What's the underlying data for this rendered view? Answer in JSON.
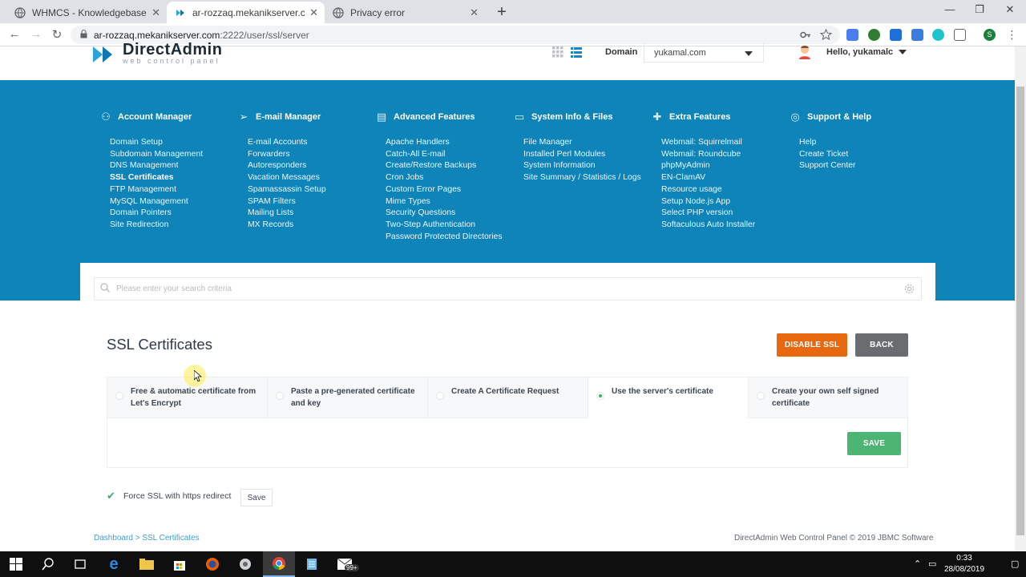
{
  "browser": {
    "tabs": [
      {
        "title": "WHMCS - Knowledgebase"
      },
      {
        "title": "ar-rozzaq.mekanikserver.com | S"
      },
      {
        "title": "Privacy error"
      }
    ],
    "url_host": "ar-rozzaq.mekanikserver.com",
    "url_path": ":2222/user/ssl/server"
  },
  "header": {
    "logo_title": "DirectAdmin",
    "logo_subtitle": "web control panel",
    "domain_label": "Domain",
    "domain_value": "yukamal.com",
    "greeting": "Hello, yukamalc"
  },
  "menu": [
    {
      "title": "Account Manager",
      "icon": "users-icon",
      "items": [
        "Domain Setup",
        "Subdomain Management",
        "DNS Management",
        "SSL Certificates",
        "FTP Management",
        "MySQL Management",
        "Domain Pointers",
        "Site Redirection"
      ]
    },
    {
      "title": "E-mail Manager",
      "icon": "paper-plane-icon",
      "items": [
        "E-mail Accounts",
        "Forwarders",
        "Autoresponders",
        "Vacation Messages",
        "Spamassassin Setup",
        "SPAM Filters",
        "Mailing Lists",
        "MX Records"
      ]
    },
    {
      "title": "Advanced Features",
      "icon": "table-icon",
      "items": [
        "Apache Handlers",
        "Catch-All E-mail",
        "Create/Restore Backups",
        "Cron Jobs",
        "Custom Error Pages",
        "Mime Types",
        "Security Questions",
        "Two-Step Authentication",
        "Password Protected Directories"
      ]
    },
    {
      "title": "System Info & Files",
      "icon": "drive-icon",
      "items": [
        "File Manager",
        "Installed Perl Modules",
        "System Information",
        "Site Summary / Statistics / Logs"
      ]
    },
    {
      "title": "Extra Features",
      "icon": "plus-icon",
      "items": [
        "Webmail: Squirrelmail",
        "Webmail: Roundcube",
        "phpMyAdmin",
        "EN-ClamAV",
        "Resource usage",
        "Setup Node.js App",
        "Select PHP version",
        "Softaculous Auto Installer"
      ]
    },
    {
      "title": "Support & Help",
      "icon": "lifebuoy-icon",
      "items": [
        "Help",
        "Create Ticket",
        "Support Center"
      ]
    }
  ],
  "search": {
    "placeholder": "Please enter your search criteria"
  },
  "main": {
    "title": "SSL Certificates",
    "disable_ssl": "DISABLE SSL",
    "back": "BACK",
    "options": [
      "Free & automatic certificate from Let's Encrypt",
      "Paste a pre-generated certificate and key",
      "Create A Certificate Request",
      "Use the server's certificate",
      "Create your own self signed certificate"
    ],
    "selected_option_index": 3,
    "save": "SAVE",
    "force_ssl_label": "Force SSL with https redirect",
    "force_ssl_checked": true,
    "force_save": "Save"
  },
  "footer": {
    "breadcrumb": "Dashboard > SSL Certificates",
    "copyright": "DirectAdmin Web Control Panel © 2019 JBMC Software"
  },
  "taskbar": {
    "badge": "99+",
    "time": "0:33",
    "date": "28/08/2019"
  },
  "colors": {
    "brand_blue": "#0e84b8",
    "disable_orange": "#e7680f",
    "back_gray": "#6a6d70",
    "save_green": "#4cb573"
  }
}
